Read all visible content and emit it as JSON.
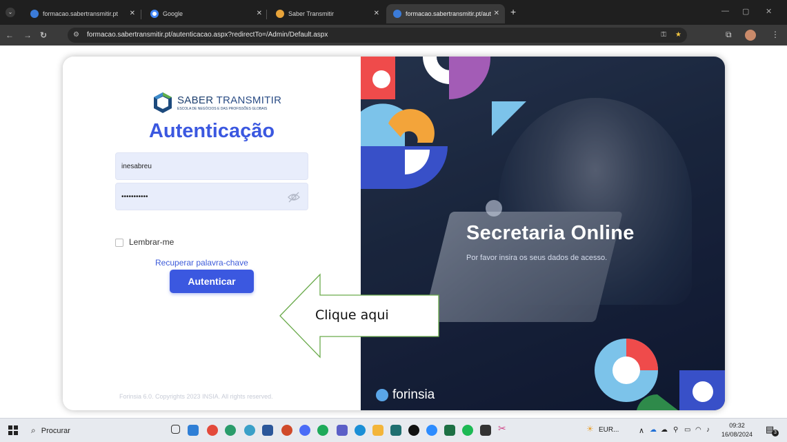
{
  "browser": {
    "tabs": [
      {
        "title": "formacao.sabertransmitir.pt",
        "color": "#3b7bd8"
      },
      {
        "title": "Google",
        "color": "#ffffff"
      },
      {
        "title": "Saber Transmitir",
        "color": "#e8a43a"
      },
      {
        "title": "formacao.sabertransmitir.pt/aut",
        "color": "#3b7bd8"
      }
    ],
    "url": "formacao.sabertransmitir.pt/autenticacao.aspx?redirectTo=/Admin/Default.aspx"
  },
  "login": {
    "logo_line1": "SABER",
    "logo_line1b": "TRANSMITIR",
    "logo_line2": "ESCOLA DE NEGÓCIOS E DAS PROFISSÕES GLOBAIS",
    "title": "Autenticação",
    "username": "inesabreu",
    "password": "•••••••••••",
    "remember": "Lembrar-me",
    "recover": "Recuperar palavra-chave",
    "submit": "Autenticar",
    "copyright": "Forinsia 6.0. Copyrights 2023 INSIA. All rights reserved."
  },
  "annotation": {
    "text": "Clique aqui"
  },
  "hero": {
    "headline": "Secretaria Online",
    "subtitle": "Por favor insira os seus dados de acesso.",
    "brand": "forinsia"
  },
  "taskbar": {
    "search": "Procurar",
    "tray_text": "EUR...",
    "time": "09:32",
    "date": "16/08/2024",
    "notif_count": "3"
  }
}
